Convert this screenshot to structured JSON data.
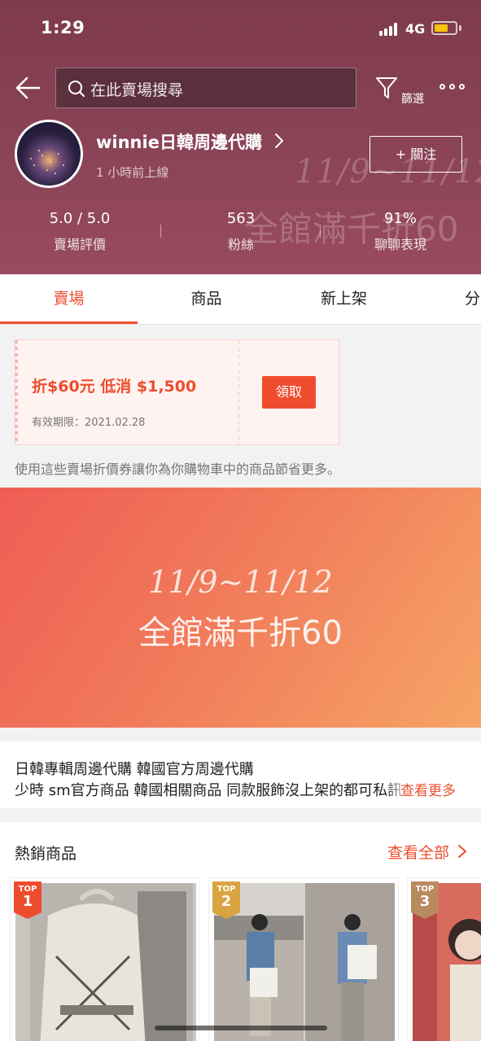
{
  "status_bar": {
    "time": "1:29",
    "network": "4G"
  },
  "nav": {
    "search_placeholder": "在此賣場搜尋",
    "filter_label": "篩選"
  },
  "shop": {
    "name": "winnie日韓周邊代購",
    "online_status": "1 小時前上線",
    "follow_label": "+ 關注"
  },
  "stats": [
    {
      "value": "5.0 / 5.0",
      "label": "賣場評價"
    },
    {
      "value": "563",
      "label": "粉絲"
    },
    {
      "value": "91%",
      "label": "聊聊表現"
    }
  ],
  "tabs": [
    "賣場",
    "商品",
    "新上架",
    "分"
  ],
  "voucher": {
    "title": "折$60元 低消 $1,500",
    "expiry": "有效期限：2021.02.28",
    "claim_label": "領取",
    "note": "使用這些賣場折價券讓你為你購物車中的商品節省更多。"
  },
  "banner": {
    "date_text": "11/9~11/12",
    "promo_text": "全館滿千折60"
  },
  "description": {
    "line1": "日韓專輯周邊代購 韓國官方周邊代購",
    "line2": "少時 sm官方商品 韓國相關商品 同款服飾沒上架的都可私訊",
    "more_label": "查看更多"
  },
  "hot_products": {
    "title": "熱銷商品",
    "see_all_label": "查看全部",
    "items": [
      {
        "rank_label": "TOP",
        "rank": "1",
        "badge_color": "#ee4d2d"
      },
      {
        "rank_label": "TOP",
        "rank": "2",
        "badge_color": "#d9a441"
      },
      {
        "rank_label": "TOP",
        "rank": "3",
        "badge_color": "#b98a5e"
      }
    ]
  },
  "colors": {
    "accent": "#ee4d2d",
    "header_bg": "#843f52"
  }
}
